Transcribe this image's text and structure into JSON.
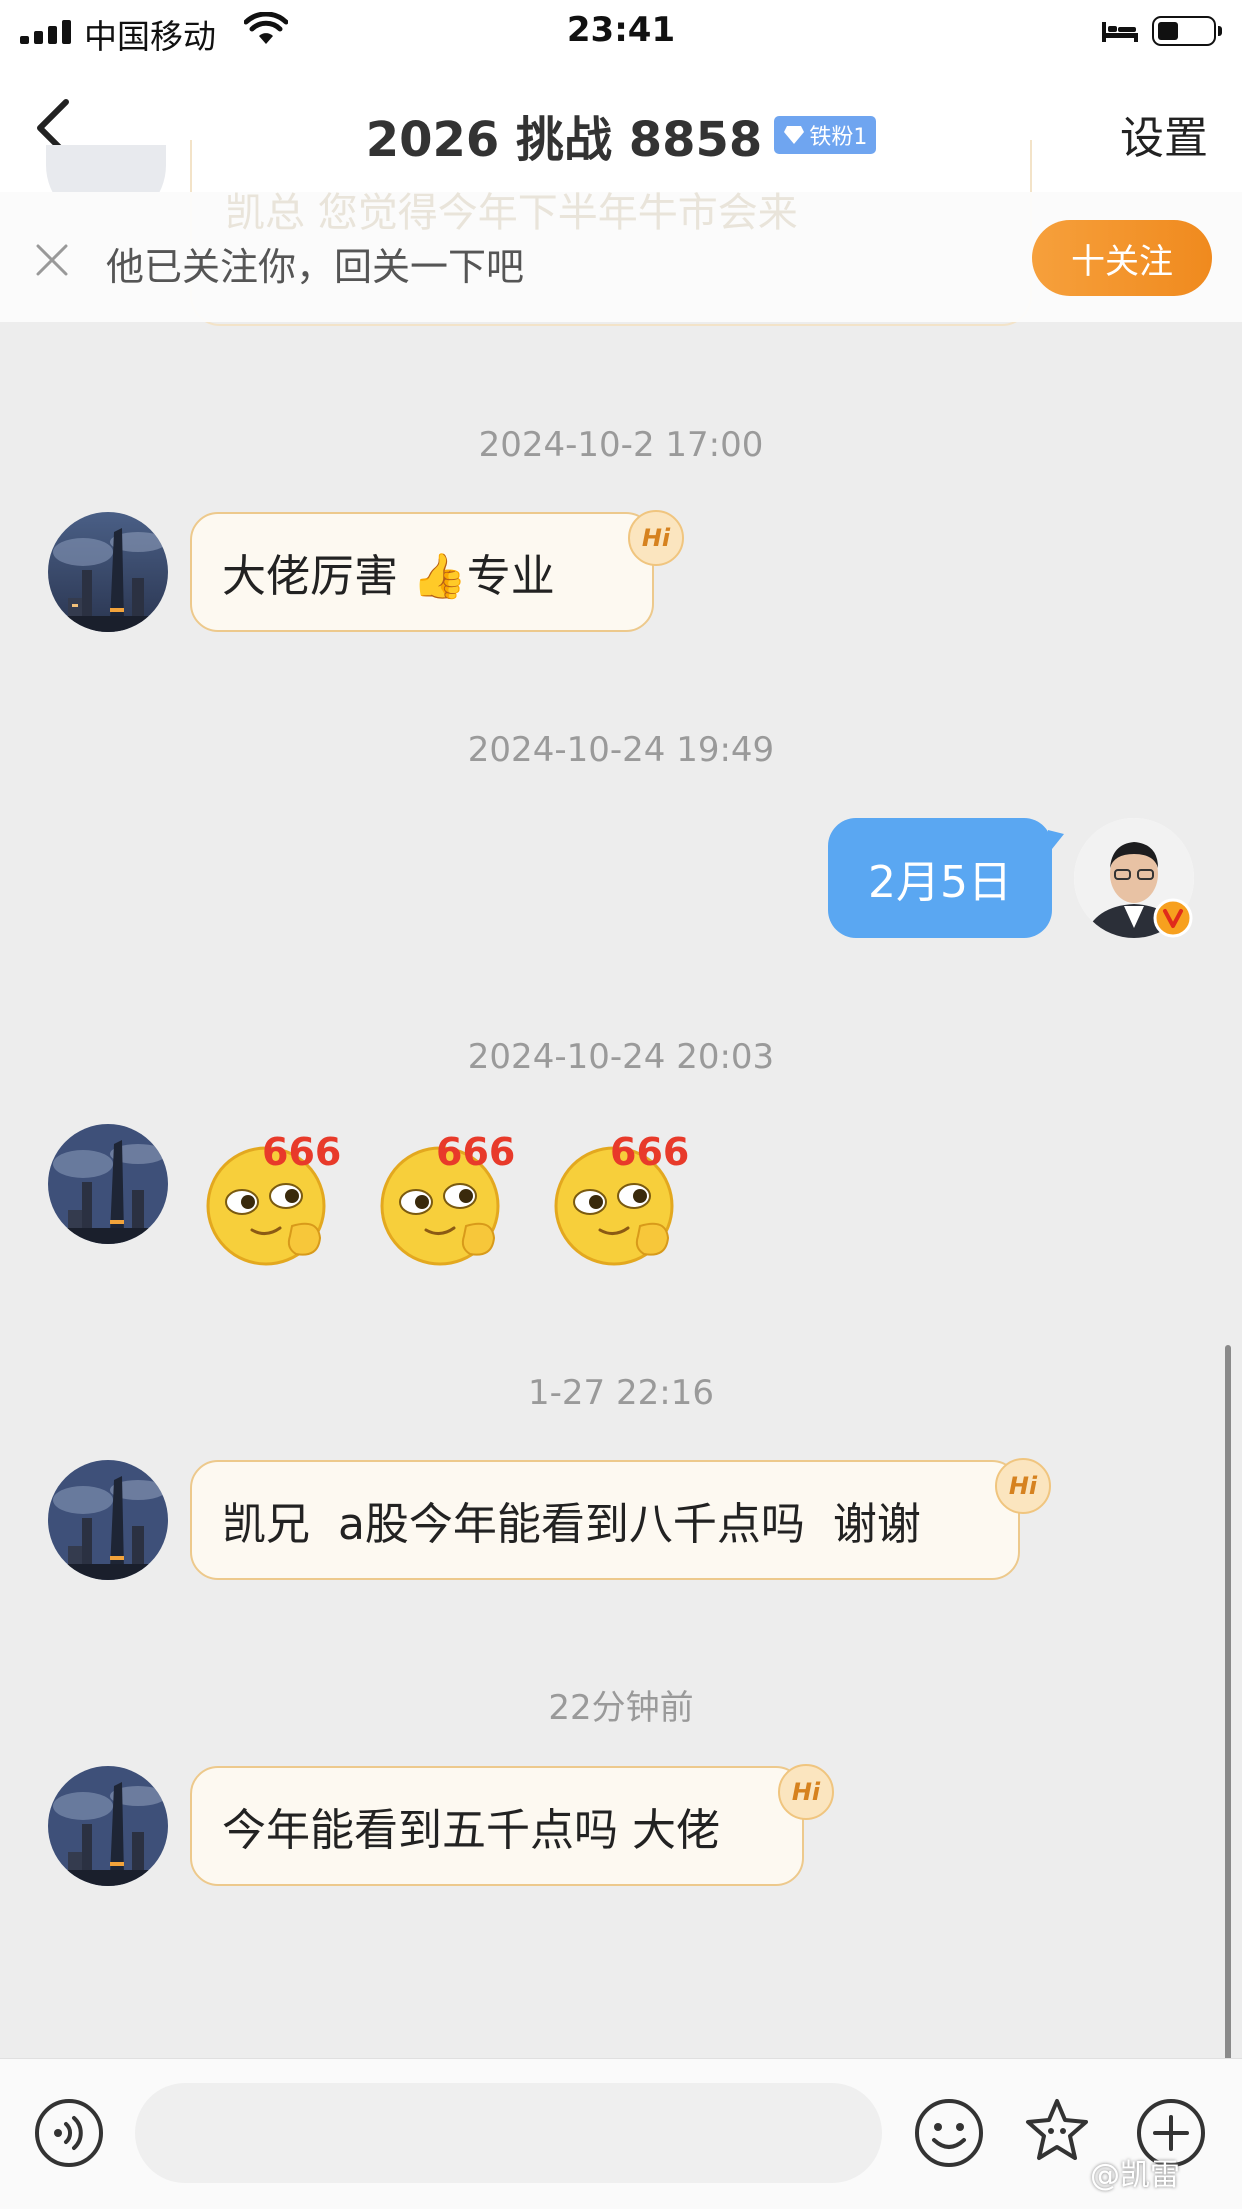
{
  "status_bar": {
    "carrier": "中国移动",
    "time": "23:41"
  },
  "nav": {
    "title": "2026 挑战 8858",
    "fan_badge": "铁粉1",
    "settings_label": "设置"
  },
  "follow_banner": {
    "text": "他已关注你，回关一下吧",
    "button_label": "十关注",
    "hidden_preview": "凯总 您觉得今年下半年牛市会来"
  },
  "messages": [
    {
      "timestamp": "2024-10-2 17:00",
      "direction": "incoming",
      "text": "大佬厉害 👍专业",
      "hi": "Hi"
    },
    {
      "timestamp": "2024-10-24 19:49",
      "direction": "outgoing",
      "text": "2月5日"
    },
    {
      "timestamp": "2024-10-24 20:03",
      "direction": "incoming",
      "stickers": [
        "666",
        "666",
        "666"
      ]
    },
    {
      "timestamp": "1-27 22:16",
      "direction": "incoming",
      "text": "凯兄  a股今年能看到八千点吗  谢谢",
      "hi": "Hi"
    },
    {
      "timestamp": "22分钟前",
      "direction": "incoming",
      "text": "今年能看到五千点吗 大佬",
      "hi": "Hi"
    }
  ],
  "input_bar": {
    "placeholder": "",
    "icons": [
      "voice-icon",
      "emoji-icon",
      "sticker-icon",
      "plus-icon"
    ]
  },
  "watermark": "@凯雷",
  "colors": {
    "accent_orange": "#f08a1e",
    "outgoing_bubble": "#5aa7f2",
    "incoming_border": "#edc98c",
    "background": "#ededed"
  }
}
